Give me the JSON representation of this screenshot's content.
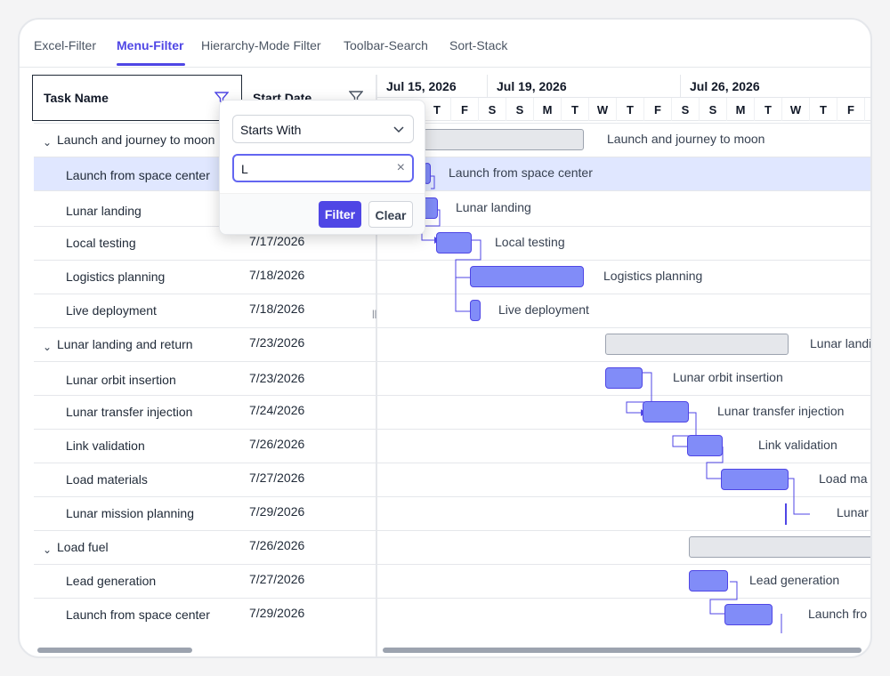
{
  "tabs": [
    {
      "label": "Excel-Filter",
      "active": false
    },
    {
      "label": "Menu-Filter",
      "active": true
    },
    {
      "label": "Hierarchy-Mode Filter",
      "active": false
    },
    {
      "label": "Toolbar-Search",
      "active": false
    },
    {
      "label": "Sort-Stack",
      "active": false
    }
  ],
  "columns": {
    "task": "Task Name",
    "start": "Start Date"
  },
  "filter_popup": {
    "operator": "Starts With",
    "value": "L",
    "filter_label": "Filter",
    "clear_label": "Clear"
  },
  "weeks": [
    "Jul 15, 2026",
    "Jul 19, 2026",
    "Jul 26, 2026"
  ],
  "days": [
    "T",
    "F",
    "S",
    "S",
    "M",
    "T",
    "W",
    "T",
    "F",
    "S",
    "S",
    "M",
    "T",
    "W",
    "T",
    "F",
    "S"
  ],
  "rows": [
    {
      "name": "Launch and journey to moon",
      "date": "",
      "parent": true,
      "label": "Launch and journey to moon"
    },
    {
      "name": "Launch from space center",
      "date": "",
      "parent": false,
      "selected": true,
      "label": "Launch from space center"
    },
    {
      "name": "Lunar landing",
      "date": "",
      "parent": false,
      "label": "Lunar landing"
    },
    {
      "name": "Local testing",
      "date": "7/17/2026",
      "parent": false,
      "label": "Local testing"
    },
    {
      "name": "Logistics planning",
      "date": "7/18/2026",
      "parent": false,
      "label": "Logistics planning"
    },
    {
      "name": "Live deployment",
      "date": "7/18/2026",
      "parent": false,
      "label": "Live deployment"
    },
    {
      "name": "Lunar landing and return",
      "date": "7/23/2026",
      "parent": true,
      "label": "Lunar landi"
    },
    {
      "name": "Lunar orbit insertion",
      "date": "7/23/2026",
      "parent": false,
      "label": "Lunar orbit insertion"
    },
    {
      "name": "Lunar transfer injection",
      "date": "7/24/2026",
      "parent": false,
      "label": "Lunar transfer injection"
    },
    {
      "name": "Link validation",
      "date": "7/26/2026",
      "parent": false,
      "label": "Link validation"
    },
    {
      "name": "Load materials",
      "date": "7/27/2026",
      "parent": false,
      "label": "Load ma"
    },
    {
      "name": "Lunar mission planning",
      "date": "7/29/2026",
      "parent": false,
      "label": "Lunar"
    },
    {
      "name": "Load fuel",
      "date": "7/26/2026",
      "parent": true,
      "label": ""
    },
    {
      "name": "Lead generation",
      "date": "7/27/2026",
      "parent": false,
      "label": "Lead generation"
    },
    {
      "name": "Launch from space center",
      "date": "7/29/2026",
      "parent": false,
      "label": "Launch fro"
    }
  ],
  "colors": {
    "accent": "#4f46e5",
    "bar": "#818cf8",
    "selected_row": "#e0e7ff"
  }
}
